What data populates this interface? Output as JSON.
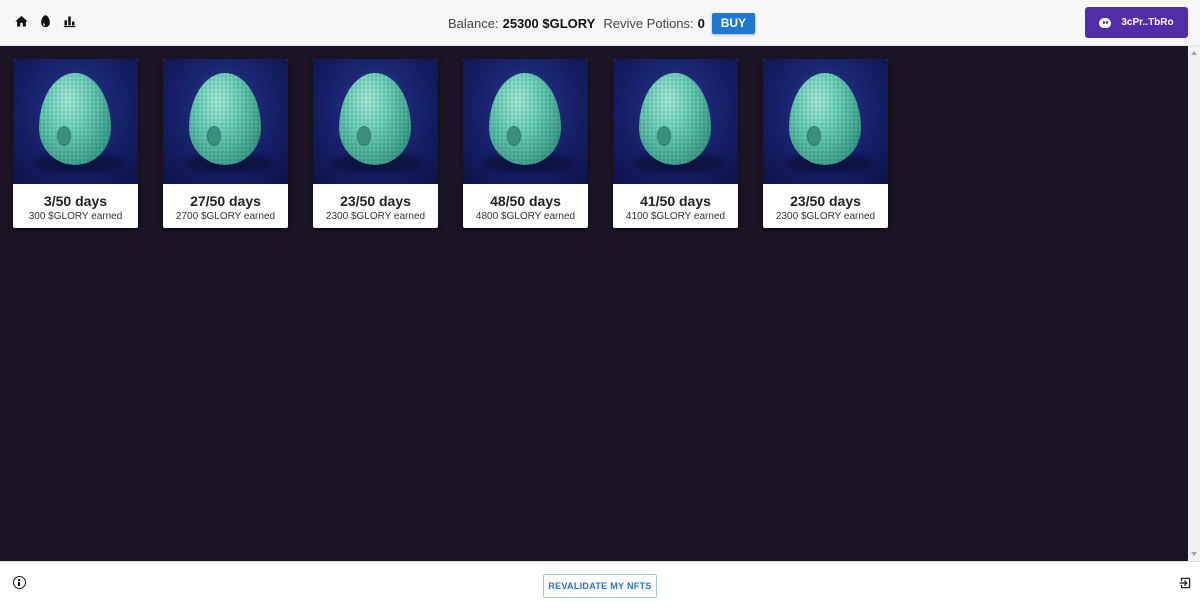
{
  "header": {
    "nav_icons": [
      "home-icon",
      "egg-icon",
      "stats-icon"
    ],
    "balance_label": "Balance:",
    "balance_value": "25300 $GLORY",
    "potions_label": "Revive Potions:",
    "potions_value": "0",
    "buy_label": "BUY",
    "wallet_label": "3cPr..TbRo"
  },
  "cards": [
    {
      "days": "3/50 days",
      "earned": "300 $GLORY earned"
    },
    {
      "days": "27/50 days",
      "earned": "2700 $GLORY earned"
    },
    {
      "days": "23/50 days",
      "earned": "2300 $GLORY earned"
    },
    {
      "days": "48/50 days",
      "earned": "4800 $GLORY earned"
    },
    {
      "days": "41/50 days",
      "earned": "4100 $GLORY earned"
    },
    {
      "days": "23/50 days",
      "earned": "2300 $GLORY earned"
    }
  ],
  "footer": {
    "revalidate_label": "REVALIDATE MY NFTS"
  },
  "colors": {
    "page_bg": "#1b1424",
    "buy_button": "#1f78d1",
    "wallet_button": "#512da8",
    "egg": "#6cd6bc"
  }
}
